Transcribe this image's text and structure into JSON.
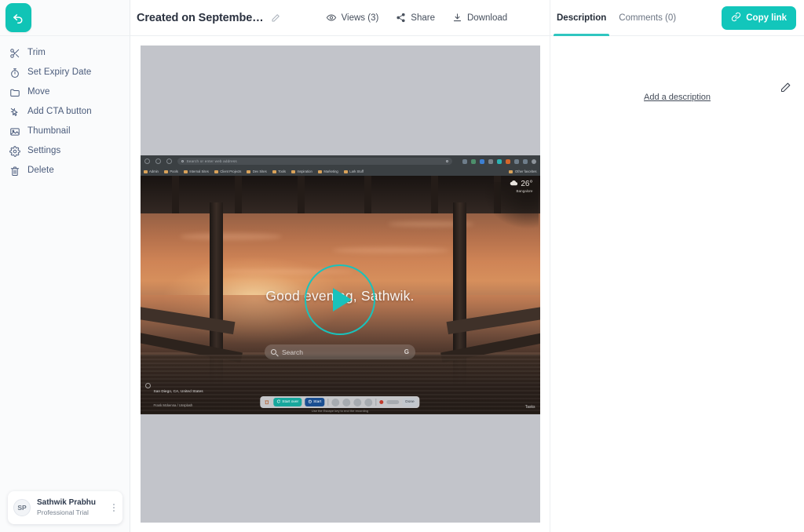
{
  "app": {
    "accent": "#12c6bb",
    "accent_dark": "#17a79c",
    "sidebar_text": "#495a7a"
  },
  "sidebar": {
    "back_button": {
      "name": "back-button",
      "icon": "back-arrow-icon"
    },
    "items": [
      {
        "label": "Trim",
        "icon": "scissors-icon"
      },
      {
        "label": "Set Expiry Date",
        "icon": "stopwatch-icon"
      },
      {
        "label": "Move",
        "icon": "folder-icon"
      },
      {
        "label": "Add CTA button",
        "icon": "cursor-click-icon"
      },
      {
        "label": "Thumbnail",
        "icon": "image-icon"
      },
      {
        "label": "Settings",
        "icon": "gear-icon"
      },
      {
        "label": "Delete",
        "icon": "trash-icon"
      }
    ],
    "user": {
      "initials": "SP",
      "name": "Sathwik Prabhu",
      "plan": "Professional Trial",
      "menu_icon": "kebab-menu-icon"
    }
  },
  "topbar": {
    "title": "Created on Septembe…",
    "title_edit_icon": "pencil-icon",
    "actions": [
      {
        "label": "Views (3)",
        "icon": "eye-icon"
      },
      {
        "label": "Share",
        "icon": "share-icon"
      },
      {
        "label": "Download",
        "icon": "download-icon"
      }
    ]
  },
  "right_panel": {
    "tabs": [
      {
        "label": "Description",
        "active": true
      },
      {
        "label": "Comments (0)",
        "active": false
      }
    ],
    "copy_link": {
      "label": "Copy link",
      "icon": "link-icon"
    },
    "edit_icon": "pencil-icon",
    "add_description": "Add a description"
  },
  "player": {
    "play_button": "play-icon",
    "video": {
      "browser": {
        "omnibox_placeholder": "Search or enter web address",
        "nav_icons": [
          "back-icon",
          "refresh-icon",
          "home-icon"
        ],
        "omnibox_search_icon": "search-icon",
        "star_icon": "bookmark-star-icon",
        "bookmarks": [
          "Admin",
          "Pools",
          "Internal Sites",
          "Client Projects",
          "Dev Sites",
          "Tools",
          "Inspiration",
          "Marketing",
          "Lark Stuff"
        ],
        "bookmarks_overflow": "Other favorites"
      },
      "weather": {
        "temperature": "26°",
        "city": "Bangalore",
        "icon": "cloud-icon"
      },
      "greeting": "Good evening, Sathwik.",
      "search": {
        "placeholder": "Search",
        "icon": "search-icon",
        "engine_badge": "G"
      },
      "photo_credit": {
        "line1": "San Diego, CA, United States",
        "line2": "Frank Mckenna / Unsplash",
        "icon": "info-icon"
      },
      "tasks_label": "Tasks",
      "recording_toolbar": {
        "delete_icon": "trash-icon",
        "buttons": [
          {
            "label": "Start over",
            "style": "teal",
            "icon": "restart-icon"
          },
          {
            "label": "Start",
            "style": "blue",
            "icon": "timer-icon"
          },
          {
            "label": "Done",
            "style": "grey"
          }
        ],
        "tools": [
          "pen-icon",
          "eraser-icon",
          "highlighter-icon",
          "blur-icon"
        ],
        "record_dot": "record-icon",
        "caption": "Use the Escape key to end the recording"
      }
    }
  }
}
